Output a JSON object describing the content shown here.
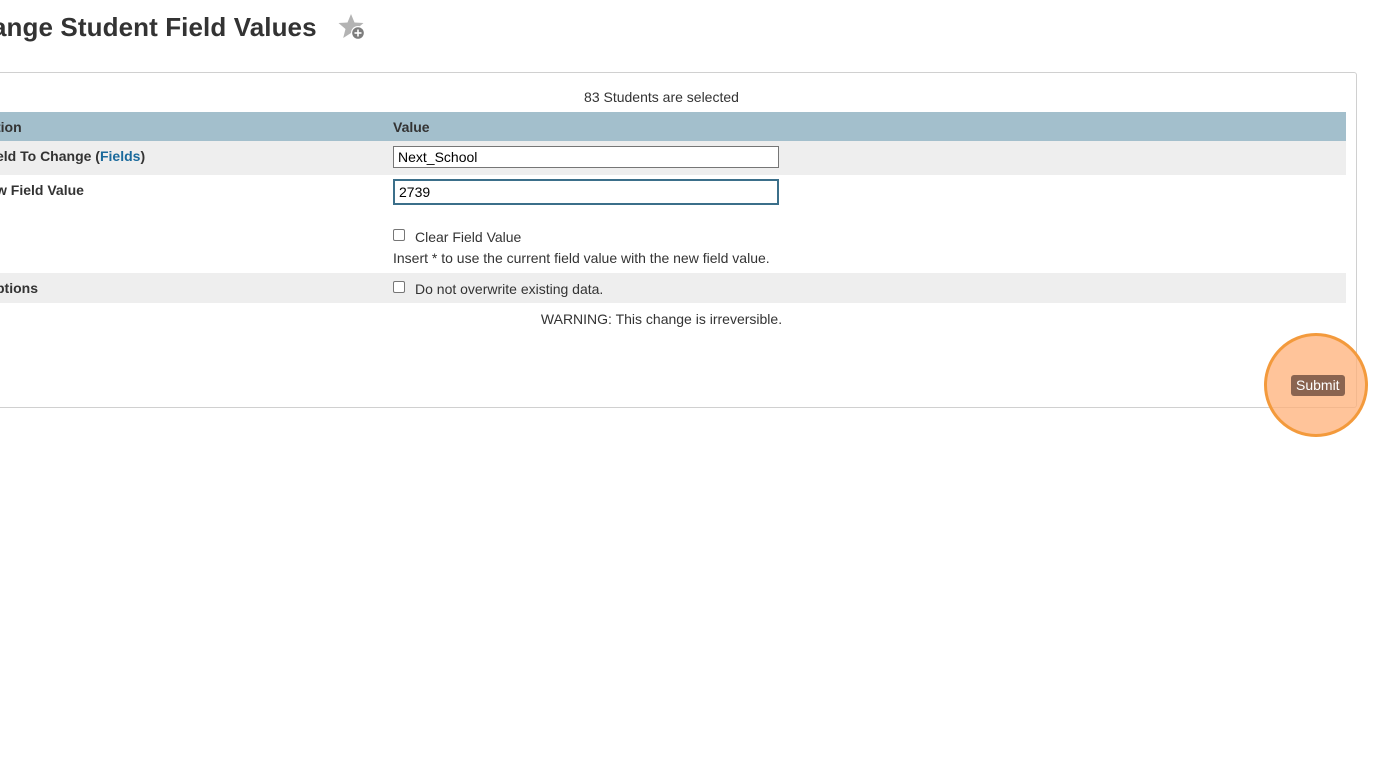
{
  "page": {
    "title": "ange Student Field Values"
  },
  "form": {
    "selected_count": "83 Students are selected",
    "columns": {
      "option": "tion",
      "value": "Value"
    },
    "field_to_change": {
      "label_prefix": "eld To Change (",
      "link_text": "Fields",
      "label_suffix": ")",
      "value": "Next_School"
    },
    "new_field_value": {
      "label": "w Field Value",
      "value": "2739"
    },
    "clear_field": {
      "label": "Clear Field Value",
      "checked": false
    },
    "hint": "Insert * to use the current field value with the new field value.",
    "options": {
      "label": "ptions",
      "no_overwrite_label": "Do not overwrite existing data.",
      "checked": false
    },
    "warning": "WARNING: This change is irreversible.",
    "submit_label": "Submit"
  },
  "colors": {
    "header_bg": "#a3bfcc",
    "row_shade": "#eeeeee",
    "link": "#1a6a9c",
    "submit_bg": "#8a6450",
    "highlight": "#f39a3c"
  },
  "icons": {
    "favorite": "star-plus-icon"
  }
}
